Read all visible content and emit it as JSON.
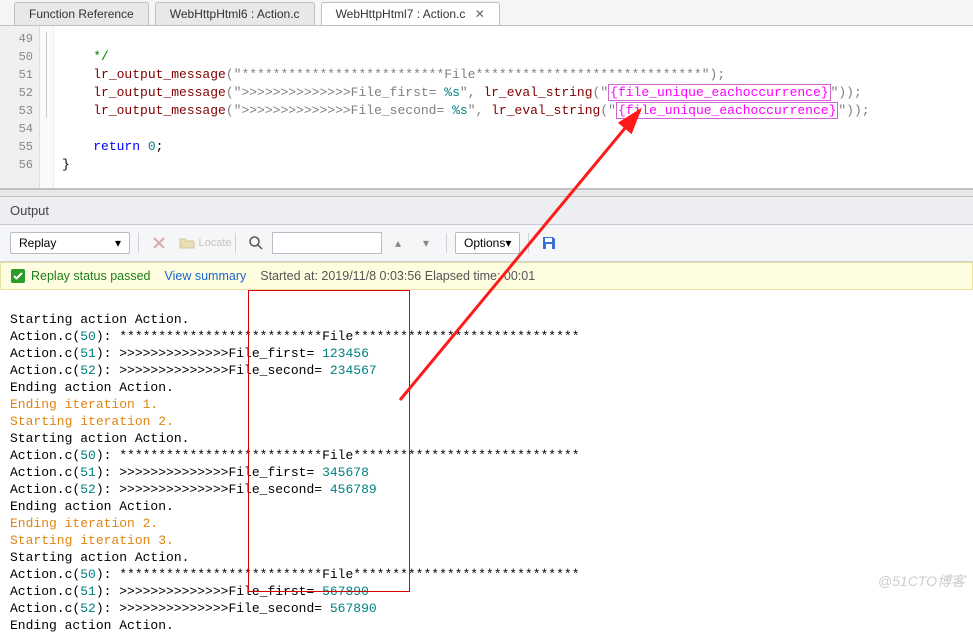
{
  "tabs": {
    "t0": "Function Reference",
    "t1": "WebHttpHtml6 : Action.c",
    "t2": "WebHttpHtml7 : Action.c",
    "close": "✕"
  },
  "gutter": {
    "l49": "49",
    "l50": "50",
    "l51": "51",
    "l52": "52",
    "l53": "53",
    "l54": "54",
    "l55": "55",
    "l56": "56"
  },
  "code": {
    "l49": "*/",
    "l50_fn": "lr_output_message",
    "l50_s1": "(\"",
    "l50_s2": "**************************File*****************************",
    "l50_s3": "\");",
    "l51_fn": "lr_output_message",
    "l51_s1": "(\"",
    "l51_s2": ">>>>>>>>>>>>>>File_first= ",
    "l51_fmt": "%s",
    "l51_s3": "\", ",
    "l51_fn2": "lr_eval_string",
    "l51_s4": "(\"",
    "l51_p": "{file_unique_eachoccurrence}",
    "l51_s5": "\"));",
    "l52_fn": "lr_output_message",
    "l52_s1": "(\"",
    "l52_s2": ">>>>>>>>>>>>>>File_second= ",
    "l52_fmt": "%s",
    "l52_s3": "\", ",
    "l52_fn2": "lr_eval_string",
    "l52_s4": "(\"",
    "l52_p": "{file_unique_eachoccurrence}",
    "l52_s5": "\"));",
    "l54_kw": "return",
    "l54_sp": " ",
    "l54_n": "0",
    "l54_end": ";",
    "l55": "}"
  },
  "output": {
    "title": "Output"
  },
  "toolbar": {
    "replay": "Replay",
    "locate": "Locate",
    "options": "Options"
  },
  "status": {
    "pass": "Replay status passed",
    "view": "View summary",
    "meta": "Started at: 2019/11/8 0:03:56 Elapsed time: 00:01"
  },
  "log": {
    "r01": "Starting action Action.",
    "r02a": "Action.c(",
    "r02n": "50",
    "r02b": "): **************************File*****************************",
    "r03a": "Action.c(",
    "r03n": "51",
    "r03b": "): >>>>>>>>>>>>>>File_first= ",
    "r03v": "123456",
    "r04a": "Action.c(",
    "r04n": "52",
    "r04b": "): >>>>>>>>>>>>>>File_second= ",
    "r04v": "234567",
    "r05": "Ending action Action.",
    "r06": "Ending iteration 1.",
    "r07": "Starting iteration 2.",
    "r08": "Starting action Action.",
    "r09a": "Action.c(",
    "r09n": "50",
    "r09b": "): **************************File*****************************",
    "r10a": "Action.c(",
    "r10n": "51",
    "r10b": "): >>>>>>>>>>>>>>File_first= ",
    "r10v": "345678",
    "r11a": "Action.c(",
    "r11n": "52",
    "r11b": "): >>>>>>>>>>>>>>File_second= ",
    "r11v": "456789",
    "r12": "Ending action Action.",
    "r13": "Ending iteration 2.",
    "r14": "Starting iteration 3.",
    "r15": "Starting action Action.",
    "r16a": "Action.c(",
    "r16n": "50",
    "r16b": "): **************************File*****************************",
    "r17a": "Action.c(",
    "r17n": "51",
    "r17b": "): >>>>>>>>>>>>>>File_first= ",
    "r17v": "567890",
    "r18a": "Action.c(",
    "r18n": "52",
    "r18b": "): >>>>>>>>>>>>>>File_second= ",
    "r18v": "567890",
    "r19": "Ending action Action."
  },
  "watermark": "@51CTO博客"
}
